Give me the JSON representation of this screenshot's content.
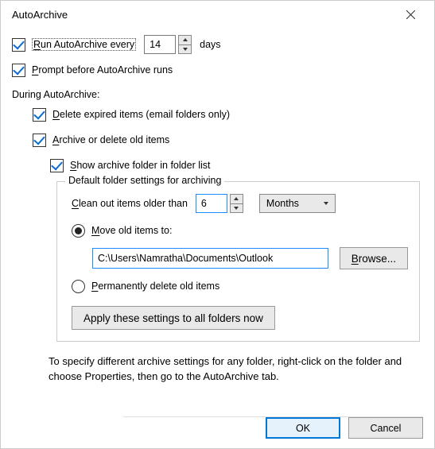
{
  "window": {
    "title": "AutoArchive"
  },
  "run": {
    "label_pre": "R",
    "label_rest": "un AutoArchive every",
    "value": "14",
    "unit": "days"
  },
  "prompt": {
    "label_pre": "P",
    "label_rest": "rompt before AutoArchive runs"
  },
  "during_label": "During AutoArchive:",
  "delete_expired": {
    "label_pre": "D",
    "label_rest": "elete expired items (email folders only)"
  },
  "archive_old": {
    "label_pre": "A",
    "label_rest": "rchive or delete old items"
  },
  "show_folder": {
    "label_pre": "S",
    "label_rest": "how archive folder in folder list"
  },
  "fieldset": {
    "legend": "Default folder settings for archiving",
    "clean": {
      "label_pre": "C",
      "label_rest": "lean out items older than",
      "value": "6",
      "unit": "Months"
    },
    "move": {
      "label_pre": "M",
      "label_rest": "ove old items to:",
      "path": "C:\\Users\\Namratha\\Documents\\Outlook",
      "browse_pre": "B",
      "browse_rest": "rowse..."
    },
    "perm": {
      "label_pre": "P",
      "label_rest": "ermanently delete old items"
    },
    "apply_label": "Apply these settings to all folders now"
  },
  "hint": "To specify different archive settings for any folder, right-click on the folder and choose Properties, then go to the AutoArchive tab.",
  "buttons": {
    "ok": "OK",
    "cancel": "Cancel"
  }
}
